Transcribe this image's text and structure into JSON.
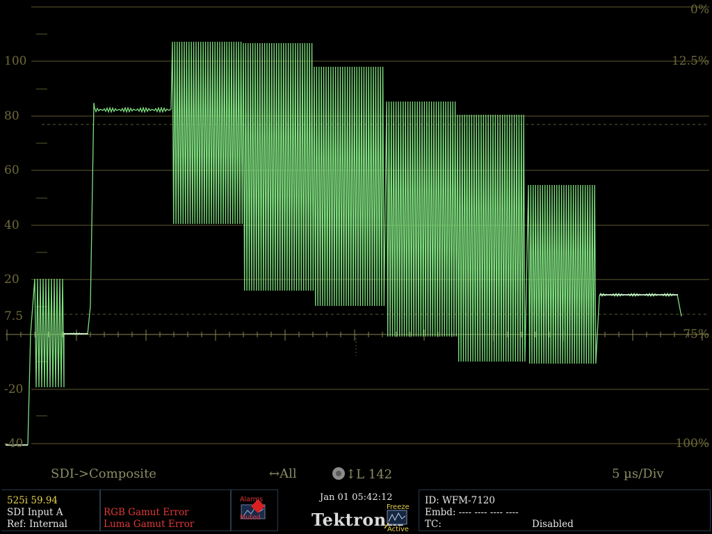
{
  "scale": {
    "left": [
      "100",
      "80",
      "60",
      "40",
      "20",
      "7.5",
      "-20",
      "-40"
    ],
    "right_top": "0%",
    "right_mid": "12.5%",
    "right_75": "75%",
    "right_bottom": "100%"
  },
  "mode": {
    "input_mode": "SDI->Composite",
    "sweep_icon": "horizontal-arrows-icon",
    "sweep_label": "All",
    "line_icon": "knob-icon",
    "line_label": "L 142",
    "timebase": "5 µs/Div"
  },
  "status": {
    "format": "525i 59.94",
    "input": "SDI Input A",
    "ref": "Ref: Internal",
    "error1": "RGB Gamut Error",
    "error2": "Luma Gamut Error",
    "alarms_line1": "Alarms",
    "alarms_line2": "Muted",
    "datetime": "Jan 01 05:42:12",
    "brand": "Tektronix",
    "freeze": "Freeze",
    "active": "Active",
    "id_line": "ID: WFM-7120",
    "embd_line": "Embd: ---- ---- ---- ----",
    "tc_label": "TC:",
    "tc_value": "Disabled"
  },
  "colors": {
    "graticule": "#5e5a2e",
    "trace": "#7fe07f",
    "trace_bright": "#e8ffe8",
    "scale_text": "#6f6a3a",
    "error": "#e03838",
    "format": "#e7d14a"
  }
}
